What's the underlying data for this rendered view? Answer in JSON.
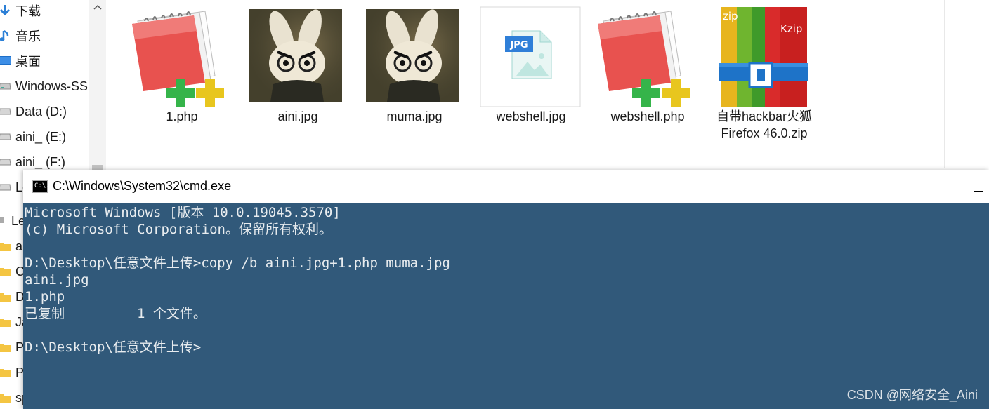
{
  "nav": {
    "items": [
      {
        "label": "下载",
        "icon": "download-arrow-icon"
      },
      {
        "label": "音乐",
        "icon": "music-note-icon"
      },
      {
        "label": "桌面",
        "icon": "desktop-icon"
      },
      {
        "label": "Windows-SS",
        "icon": "drive-icon"
      },
      {
        "label": "Data (D:)",
        "icon": "drive-icon"
      },
      {
        "label": "aini_ (E:)",
        "icon": "drive-icon"
      },
      {
        "label": "aini_ (F:)",
        "icon": "drive-icon"
      },
      {
        "label": "Le",
        "icon": "drive-icon"
      },
      {
        "label": "Le",
        "icon": "network-icon"
      },
      {
        "label": "ai",
        "icon": "folder-icon"
      },
      {
        "label": "C",
        "icon": "folder-icon"
      },
      {
        "label": "D",
        "icon": "folder-icon"
      },
      {
        "label": "Ja",
        "icon": "folder-icon"
      },
      {
        "label": "P",
        "icon": "folder-icon"
      },
      {
        "label": "Py",
        "icon": "folder-icon"
      },
      {
        "label": "sp",
        "icon": "folder-icon"
      }
    ]
  },
  "files": [
    {
      "name": "1.php",
      "icon": "editplus-php-icon"
    },
    {
      "name": "aini.jpg",
      "icon": "bunny-photo-thumbnail"
    },
    {
      "name": "muma.jpg",
      "icon": "bunny-photo-thumbnail"
    },
    {
      "name": "webshell.jpg",
      "icon": "jpg-file-icon"
    },
    {
      "name": "webshell.php",
      "icon": "editplus-php-icon"
    },
    {
      "name": "自带hackbar火狐Firefox 46.0.zip",
      "icon": "kzip-archive-icon"
    }
  ],
  "cmd": {
    "title": "C:\\Windows\\System32\\cmd.exe",
    "icon_text": "C:\\.",
    "lines": [
      "Microsoft Windows [版本 10.0.19045.3570]",
      "(c) Microsoft Corporation。保留所有权利。",
      "",
      "D:\\Desktop\\任意文件上传>copy /b aini.jpg+1.php muma.jpg",
      "aini.jpg",
      "1.php",
      "已复制         1 个文件。",
      "",
      "D:\\Desktop\\任意文件上传>"
    ]
  },
  "watermark": "CSDN @网络安全_Aini",
  "colors": {
    "console_bg": "#31597a",
    "console_fg": "#e8ecef",
    "folder_yellow": "#f4c542"
  }
}
